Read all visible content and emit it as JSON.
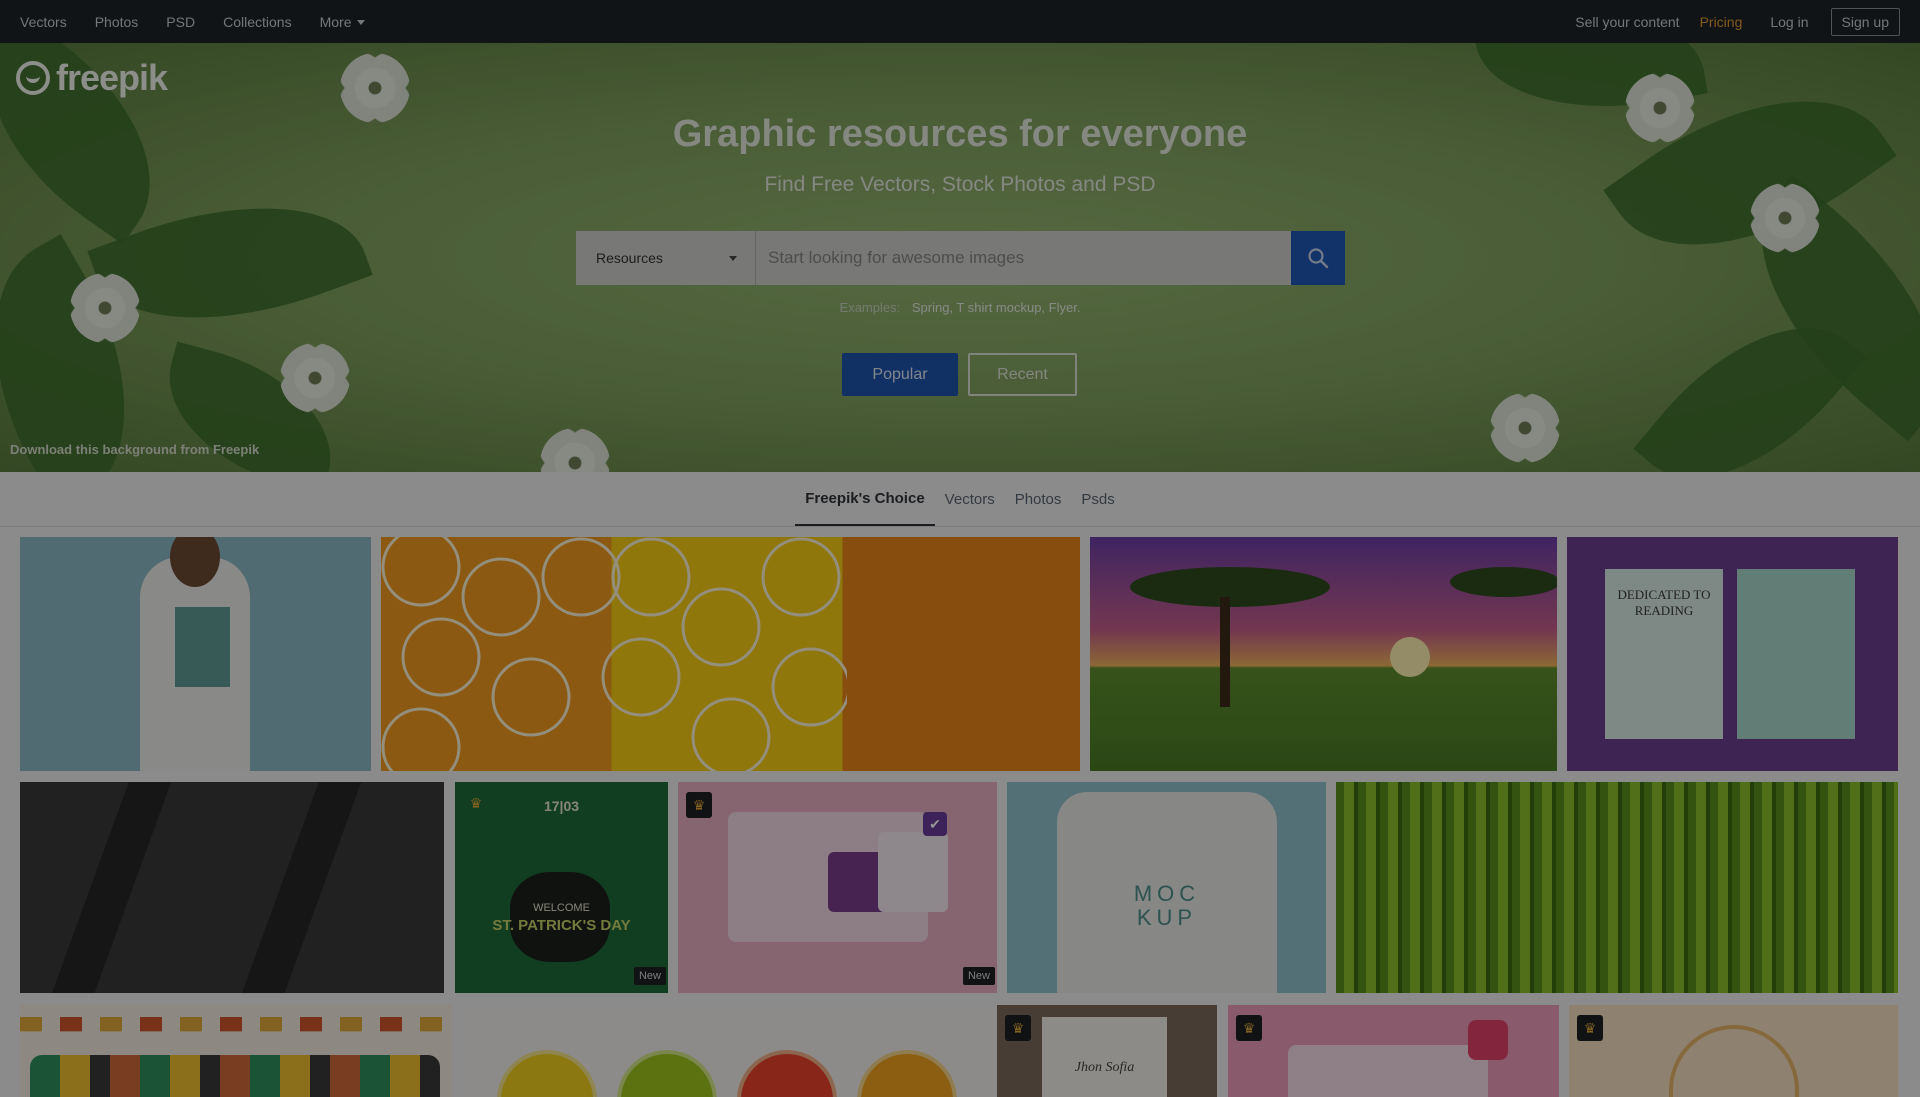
{
  "topnav": {
    "left": [
      "Vectors",
      "Photos",
      "PSD",
      "Collections",
      "More"
    ],
    "right": {
      "sell": "Sell your content",
      "pricing": "Pricing",
      "login": "Log in",
      "signup": "Sign up"
    }
  },
  "logo": "freepik",
  "hero": {
    "title": "Graphic resources for everyone",
    "subtitle": "Find Free Vectors, Stock Photos and PSD",
    "search": {
      "category": "Resources",
      "placeholder": "Start looking for awesome images"
    },
    "examples_label": "Examples:",
    "examples": "Spring, T shirt mockup, Flyer.",
    "popular": "Popular",
    "recent": "Recent",
    "credit": "Download this background from Freepik"
  },
  "tabs": [
    "Freepik's Choice",
    "Vectors",
    "Photos",
    "Psds"
  ],
  "grid": {
    "tile_book_title": "DEDICATED TO READING",
    "tile_flyer_date": "17|03",
    "tile_flyer_welcome": "WELCOME",
    "tile_flyer_title": "ST. PATRICK'S DAY",
    "tile_mockup_text": "MOC KUP",
    "new_label": "New",
    "tile_invite_title": "Jhon Sofia"
  },
  "colors": {
    "accent_blue": "#1f59b6",
    "pricing_orange": "#e09a2f",
    "nav_bg": "#1d2328"
  }
}
